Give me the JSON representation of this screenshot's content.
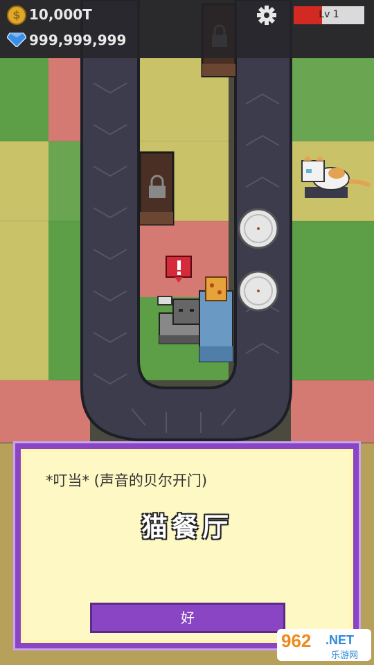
{
  "hud": {
    "gold": "10,000T",
    "gems": "999,999,999",
    "level_label": "Lv 1",
    "level_progress": 0.4
  },
  "dialog": {
    "subtitle": "*叮当* (声音的贝尔开门)",
    "title": "猫餐厅",
    "ok_label": "好"
  },
  "watermark": {
    "number": "962",
    "suffix": ".NET",
    "site": "乐游网"
  },
  "colors": {
    "accent_purple": "#8a45c4",
    "dialog_bg": "#fdf8c4",
    "level_red": "#d22a22",
    "track": "#3c3c4c"
  },
  "icons": [
    "coin-icon",
    "gem-icon",
    "settings-gear-icon",
    "lock-icon",
    "alert-icon",
    "plate-icon",
    "cat-icon",
    "pizza-icon"
  ]
}
